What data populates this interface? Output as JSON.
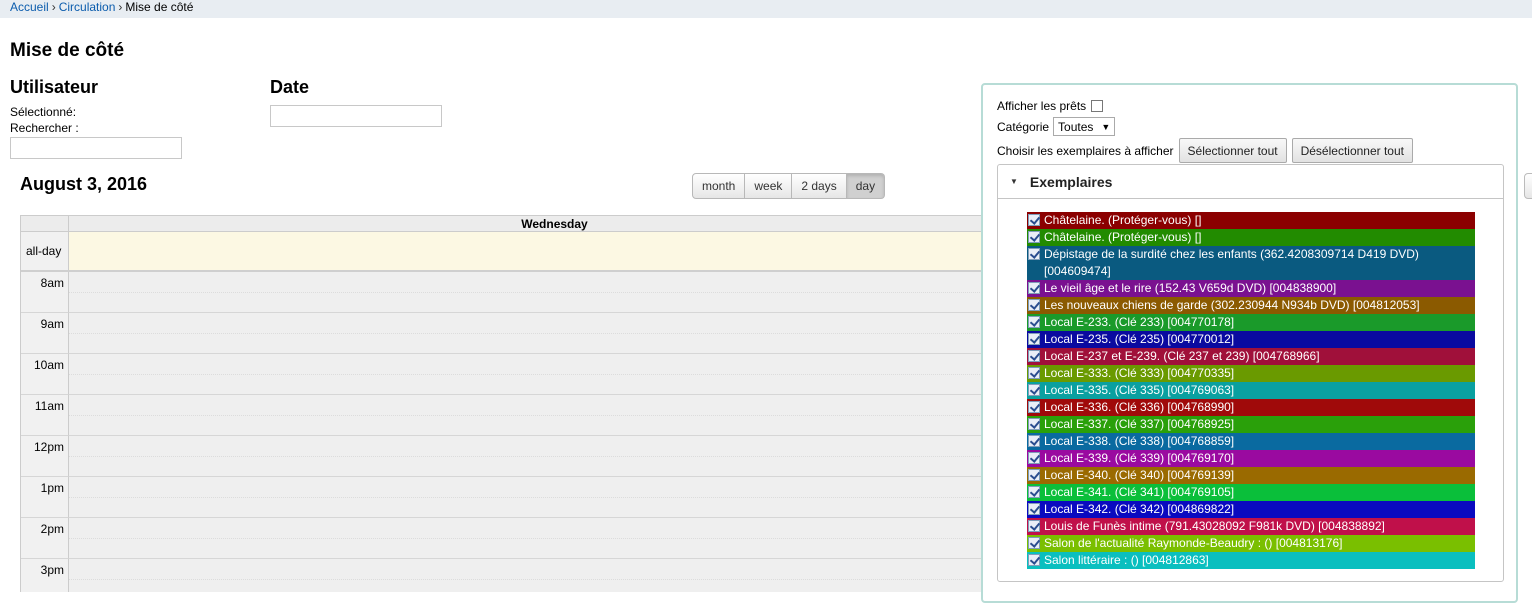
{
  "breadcrumb": {
    "home": "Accueil",
    "circulation": "Circulation",
    "current": "Mise de côté",
    "separator": "›"
  },
  "page_title": "Mise de côté",
  "user_section": {
    "heading": "Utilisateur",
    "selected_label": "Sélectionné:",
    "search_label": "Rechercher :"
  },
  "date_section": {
    "heading": "Date"
  },
  "calendar": {
    "title": "August 3, 2016",
    "views": [
      "month",
      "week",
      "2 days",
      "day"
    ],
    "active_view": "day",
    "day_header": "Wednesday",
    "allday_label": "all-day",
    "hours": [
      "8am",
      "9am",
      "10am",
      "11am",
      "12pm",
      "1pm",
      "2pm",
      "3pm"
    ]
  },
  "panel": {
    "show_loans_label": "Afficher les prêts",
    "category_label": "Catégorie",
    "category_value": "Toutes",
    "choose_label": "Choisir les exemplaires à afficher",
    "select_all_label": "Sélectionner tout",
    "deselect_all_label": "Désélectionner tout",
    "accordion_title": "Exemplaires",
    "items": [
      {
        "label": "Châtelaine. (Protéger-vous) []",
        "color": "#8b0000"
      },
      {
        "label": "Châtelaine. (Protéger-vous) []",
        "color": "#228b00"
      },
      {
        "label": "Dépistage de la surdité chez les enfants (362.4208309714 D419 DVD) [004609474]",
        "color": "#0a5a80"
      },
      {
        "label": "Le vieil âge et le rire (152.43 V659d DVD) [004838900]",
        "color": "#7a1190"
      },
      {
        "label": "Les nouveaux chiens de garde (302.230944 N934b DVD) [004812053]",
        "color": "#8b5a00"
      },
      {
        "label": "Local E-233. (Clé 233) [004770178]",
        "color": "#1a9a2a"
      },
      {
        "label": "Local E-235. (Clé 235) [004770012]",
        "color": "#0a0aa0"
      },
      {
        "label": "Local E-237 et E-239. (Clé 237 et 239) [004768966]",
        "color": "#a0103a"
      },
      {
        "label": "Local E-333. (Clé 333) [004770335]",
        "color": "#6a9a00"
      },
      {
        "label": "Local E-335. (Clé 335) [004769063]",
        "color": "#0aa0a0"
      },
      {
        "label": "Local E-336. (Clé 336) [004768990]",
        "color": "#a00a0a"
      },
      {
        "label": "Local E-337. (Clé 337) [004768925]",
        "color": "#2aa00a"
      },
      {
        "label": "Local E-338. (Clé 338) [004768859]",
        "color": "#0a6aa0"
      },
      {
        "label": "Local E-339. (Clé 339) [004769170]",
        "color": "#9a0aa0"
      },
      {
        "label": "Local E-340. (Clé 340) [004769139]",
        "color": "#9a6a00"
      },
      {
        "label": "Local E-341. (Clé 341) [004769105]",
        "color": "#0abf3a"
      },
      {
        "label": "Local E-342. (Clé 342) [004869822]",
        "color": "#0a0ac0"
      },
      {
        "label": "Louis de Funès intime (791.43028092 F981k DVD) [004838892]",
        "color": "#c0104a"
      },
      {
        "label": "Salon de l'actualité Raymonde-Beaudry : () [004813176]",
        "color": "#7abf00"
      },
      {
        "label": "Salon littéraire : () [004812863]",
        "color": "#0abfbf"
      }
    ]
  }
}
